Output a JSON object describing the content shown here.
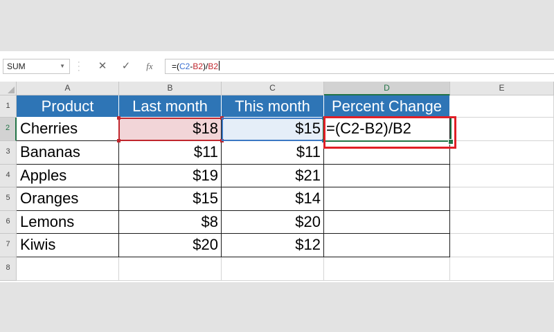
{
  "formula_bar": {
    "name_box": "SUM",
    "cancel_icon": "✕",
    "enter_icon": "✓",
    "fx_label": "fx",
    "formula_parts": [
      "=(",
      "C2",
      "-",
      "B2",
      ")/",
      "B2"
    ]
  },
  "columns": [
    "A",
    "B",
    "C",
    "D",
    "E"
  ],
  "rows": [
    "1",
    "2",
    "3",
    "4",
    "5",
    "6",
    "7",
    "8"
  ],
  "table": {
    "headers": [
      "Product",
      "Last month",
      "This month",
      "Percent Change"
    ],
    "data": [
      [
        "Cherries",
        "$18",
        "$15",
        "=(C2-B2)/B2"
      ],
      [
        "Bananas",
        "$11",
        "$11",
        ""
      ],
      [
        "Apples",
        "$19",
        "$21",
        ""
      ],
      [
        "Oranges",
        "$15",
        "$14",
        ""
      ],
      [
        "Lemons",
        "$8",
        "$20",
        ""
      ],
      [
        "Kiwis",
        "$20",
        "$12",
        ""
      ]
    ]
  },
  "colors": {
    "header_fill": "#2e75b6",
    "ref_b_color": "#c0262d",
    "ref_c_color": "#3b78c4",
    "active_cell": "#217346",
    "callout": "#e01f26"
  }
}
